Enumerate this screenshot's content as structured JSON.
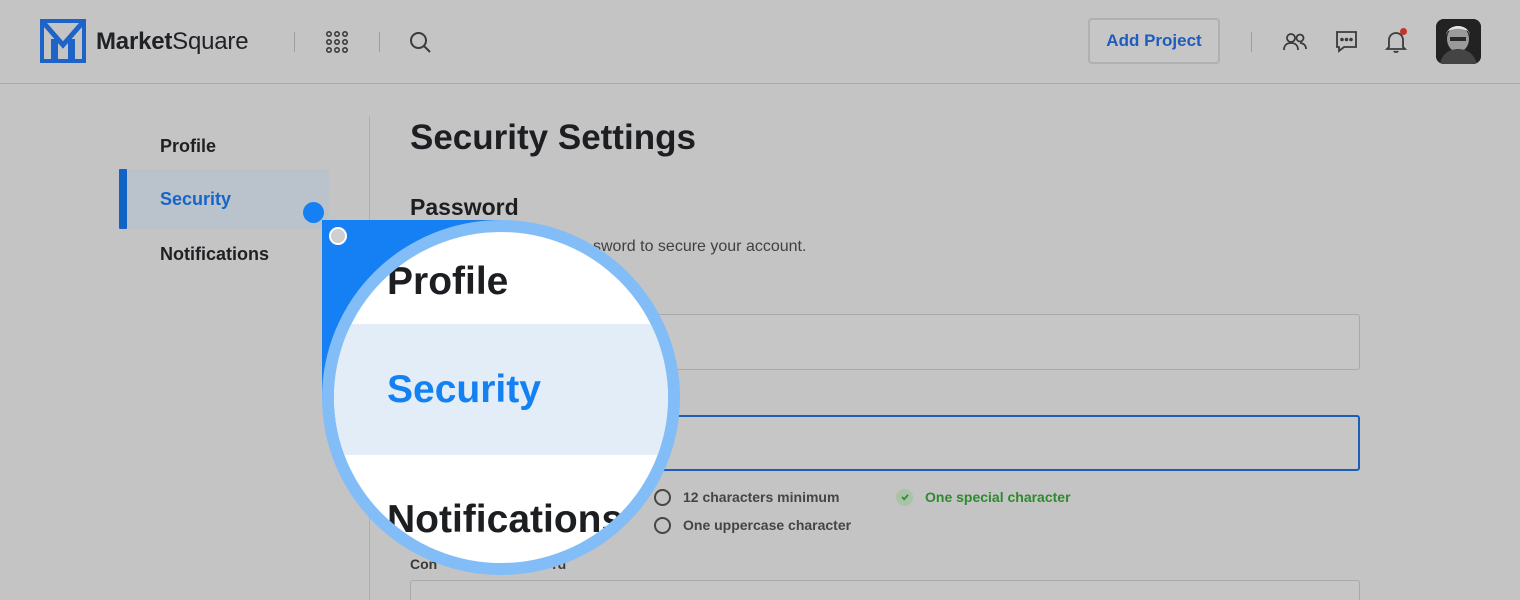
{
  "brand": {
    "name_bold": "Market",
    "name_regular": "Square"
  },
  "header": {
    "add_project_label": "Add Project",
    "icons": [
      "apps-grid-icon",
      "search-icon",
      "people-icon",
      "chat-icon",
      "bell-icon"
    ],
    "notification_dot_color": "#c8312c"
  },
  "sidebar": {
    "items": [
      {
        "label": "Profile",
        "active": false
      },
      {
        "label": "Security",
        "active": true
      },
      {
        "label": "Notifications",
        "active": false
      }
    ]
  },
  "main": {
    "title": "Security Settings",
    "password_section": {
      "title": "Password",
      "description": "sword to secure your account.",
      "confirm_label": "Con",
      "confirm_label_tail": "rd",
      "requirements": [
        {
          "label": "12 characters minimum",
          "met": false
        },
        {
          "label": "One special character",
          "met": true
        },
        {
          "label": "One uppercase character",
          "met": false
        }
      ]
    }
  },
  "magnifier": {
    "items": [
      {
        "label": "Profile"
      },
      {
        "label": "Security"
      },
      {
        "label": "Notifications"
      }
    ]
  },
  "colors": {
    "accent": "#1481f3",
    "active_text": "#1665c8",
    "success": "#2f8a2f"
  }
}
